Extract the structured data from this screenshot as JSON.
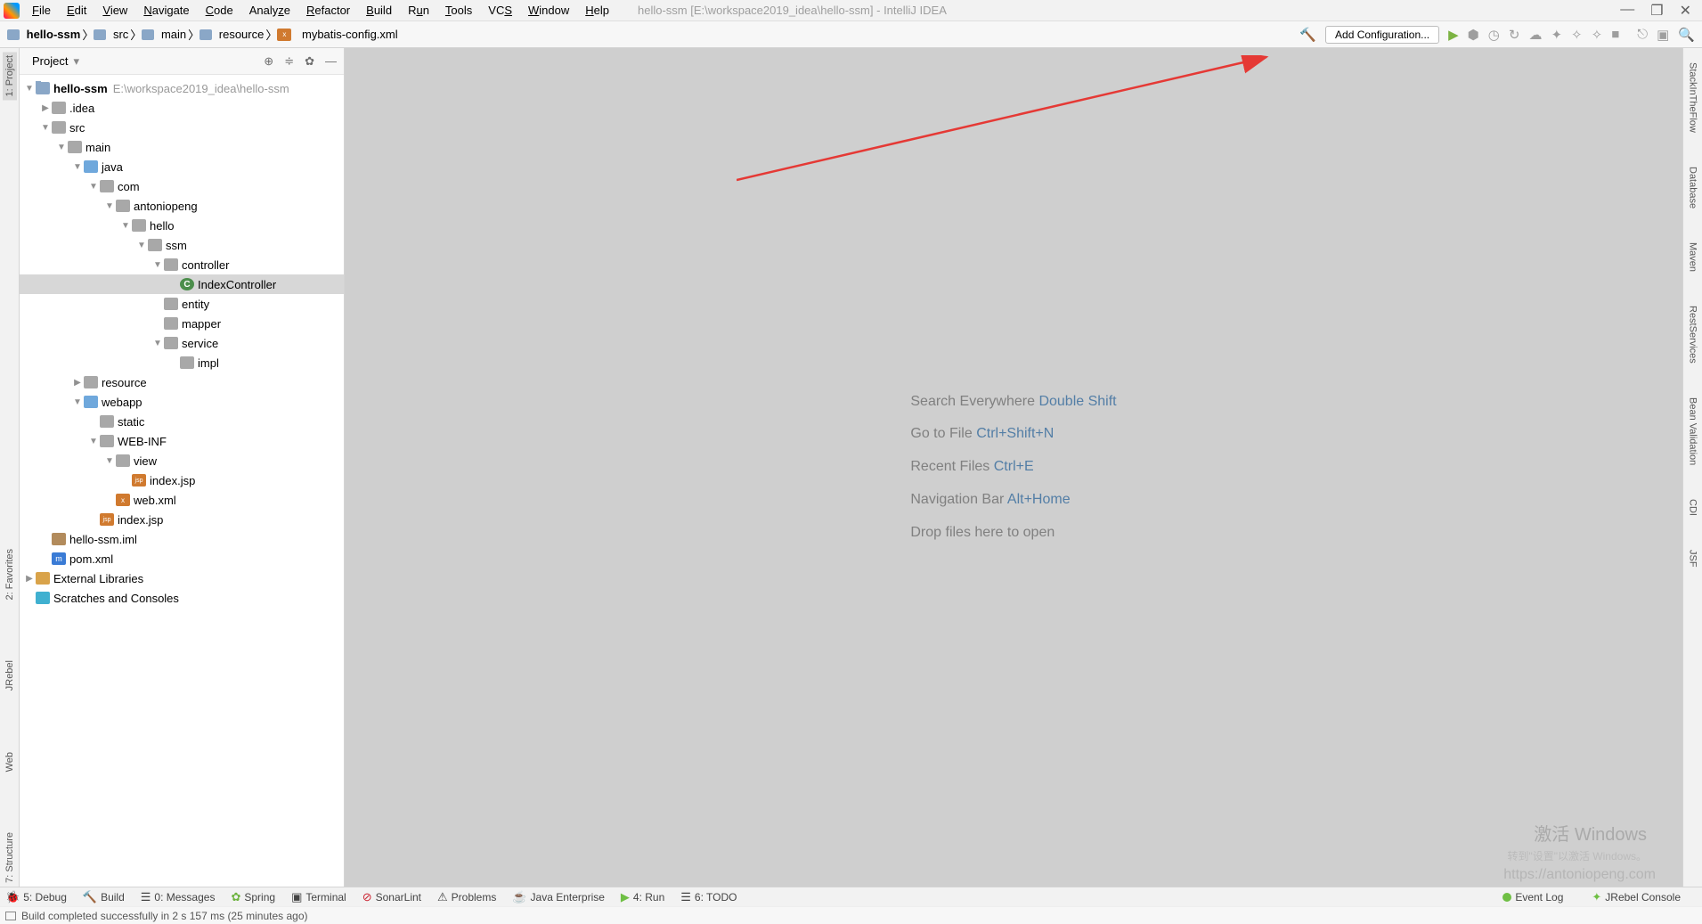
{
  "title": {
    "project": "hello-ssm",
    "path": "[E:\\workspace2019_idea\\hello-ssm]",
    "app": "IntelliJ IDEA"
  },
  "menu": [
    "File",
    "Edit",
    "View",
    "Navigate",
    "Code",
    "Analyze",
    "Refactor",
    "Build",
    "Run",
    "Tools",
    "VCS",
    "Window",
    "Help"
  ],
  "crumbs": [
    {
      "icon": "folder",
      "label": "hello-ssm",
      "bold": true
    },
    {
      "icon": "folder",
      "label": "src"
    },
    {
      "icon": "folder",
      "label": "main"
    },
    {
      "icon": "folder",
      "label": "resource"
    },
    {
      "icon": "xml",
      "label": "mybatis-config.xml"
    }
  ],
  "addcfg": "Add Configuration...",
  "left_tabs": [
    "1: Project",
    "2: Favorites",
    "JRebel",
    "Web",
    "7: Structure"
  ],
  "right_tabs": [
    "StackInTheFlow",
    "Database",
    "Maven",
    "RestServices",
    "Bean Validation",
    "CDI",
    "JSF"
  ],
  "project_title": "Project",
  "tree_root": {
    "label": "hello-ssm",
    "hint": "E:\\workspace2019_idea\\hello-ssm"
  },
  "tree": {
    "idea": ".idea",
    "src": "src",
    "main": "main",
    "java": "java",
    "com": "com",
    "antoniopeng": "antoniopeng",
    "hello": "hello",
    "ssm": "ssm",
    "controller": "controller",
    "indexcontroller": "IndexController",
    "entity": "entity",
    "mapper": "mapper",
    "service": "service",
    "impl": "impl",
    "resource": "resource",
    "webapp": "webapp",
    "static": "static",
    "webinf": "WEB-INF",
    "view": "view",
    "indexjsp": "index.jsp",
    "webxml": "web.xml",
    "indexjsp2": "index.jsp",
    "iml": "hello-ssm.iml",
    "pom": "pom.xml",
    "extlib": "External Libraries",
    "scratch": "Scratches and Consoles"
  },
  "hints": [
    {
      "t": "Search Everywhere",
      "s": "Double Shift"
    },
    {
      "t": "Go to File",
      "s": "Ctrl+Shift+N"
    },
    {
      "t": "Recent Files",
      "s": "Ctrl+E"
    },
    {
      "t": "Navigation Bar",
      "s": "Alt+Home"
    },
    {
      "t": "Drop files here to open",
      "s": ""
    }
  ],
  "wm1": "激活 Windows",
  "wm2": "转到\"设置\"以激活 Windows。",
  "wm3": "https://antoniopeng.com",
  "footer": {
    "debug": "5: Debug",
    "build": "Build",
    "messages": "0: Messages",
    "spring": "Spring",
    "terminal": "Terminal",
    "sonar": "SonarLint",
    "problems": "Problems",
    "jent": "Java Enterprise",
    "run": "4: Run",
    "todo": "6: TODO",
    "eventlog": "Event Log",
    "jrebel": "JRebel Console"
  },
  "status": "Build completed successfully in 2 s 157 ms (25 minutes ago)"
}
